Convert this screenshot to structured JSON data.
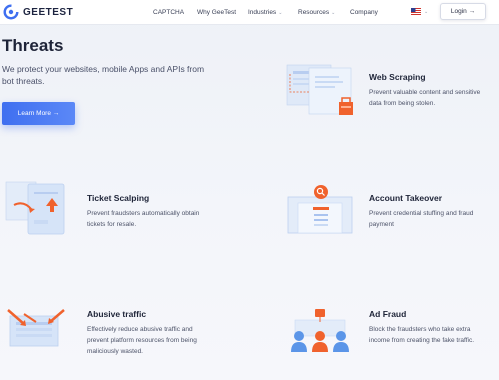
{
  "header": {
    "logo_text": "GEETEST",
    "nav": [
      {
        "label": "CAPTCHA",
        "dropdown": false
      },
      {
        "label": "Why GeeTest",
        "dropdown": false
      },
      {
        "label": "Industries",
        "dropdown": true
      },
      {
        "label": "Resources",
        "dropdown": true
      },
      {
        "label": "Company",
        "dropdown": false
      }
    ],
    "language_icon": "us-flag-icon",
    "login_label": "Login →"
  },
  "hero": {
    "title": "Threats",
    "subtitle": "We protect your websites, mobile Apps and APIs from bot threats.",
    "cta_label": "Learn More →"
  },
  "threats": [
    {
      "title": "Web Scraping",
      "description": "Prevent valuable content and sensitive data from being stolen.",
      "icon": "web-scraping-illustration"
    },
    {
      "title": "Ticket Scalping",
      "description": "Prevent fraudsters automatically obtain tickets for resale.",
      "icon": "ticket-scalping-illustration"
    },
    {
      "title": "Account Takeover",
      "description": "Prevent credential stuffing and fraud payment",
      "icon": "account-takeover-illustration"
    },
    {
      "title": "Abusive traffic",
      "description": "Effectively reduce abusive traffic and prevent platform resources from being maliciously wasted.",
      "icon": "abusive-traffic-illustration"
    },
    {
      "title": "Ad Fraud",
      "description": "Block the fraudsters who take extra income from creating the fake traffic.",
      "icon": "ad-fraud-illustration"
    }
  ],
  "colors": {
    "accent": "#3f6ff0",
    "danger": "#f0622d",
    "light_blue": "#c9dbf5"
  }
}
